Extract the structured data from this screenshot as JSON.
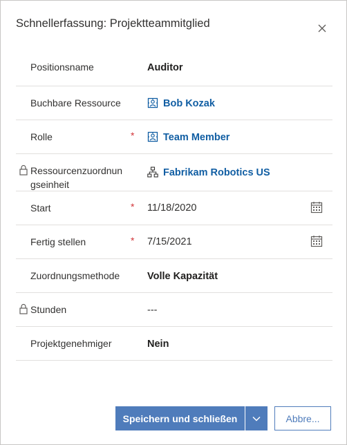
{
  "dialog": {
    "title": "Schnellerfassung: Projektteammitglied",
    "close_icon": "close-icon"
  },
  "fields": [
    {
      "label": "Positionsname",
      "required": "",
      "value": "Auditor",
      "locked": false,
      "style": "bold"
    },
    {
      "label": "Buchbare Ressource",
      "required": "",
      "value": "Bob Kozak",
      "locked": false,
      "style": "link",
      "icon": "resource-icon"
    },
    {
      "label": "Rolle",
      "required": "*",
      "value": "Team Member",
      "locked": false,
      "style": "link",
      "icon": "resource-icon"
    },
    {
      "label": "Ressourcenzuordnungseinheit",
      "label_line1": "Ressourcenzuordnun",
      "label_line2": "gseinheit",
      "required": "",
      "value": "Fabrikam Robotics US",
      "locked": true,
      "style": "link",
      "icon": "org-unit-icon"
    },
    {
      "label": "Start",
      "required": "*",
      "value": "11/18/2020",
      "locked": false,
      "style": "light",
      "icon": "calendar-icon"
    },
    {
      "label": "Fertig stellen",
      "required": "*",
      "value": "7/15/2021",
      "locked": false,
      "style": "light",
      "icon": "calendar-icon"
    },
    {
      "label": "Zuordnungsmethode",
      "required": "",
      "value": "Volle Kapazität",
      "locked": false,
      "style": "bold"
    },
    {
      "label": "Stunden",
      "required": "",
      "value": "---",
      "locked": true,
      "style": "light"
    },
    {
      "label": "Projektgenehmiger",
      "required": "",
      "value": "Nein",
      "locked": false,
      "style": "bold"
    }
  ],
  "footer": {
    "save_label": "Speichern und schließen",
    "cancel_label": "Abbre...",
    "accent_color": "#4f7cbb"
  }
}
